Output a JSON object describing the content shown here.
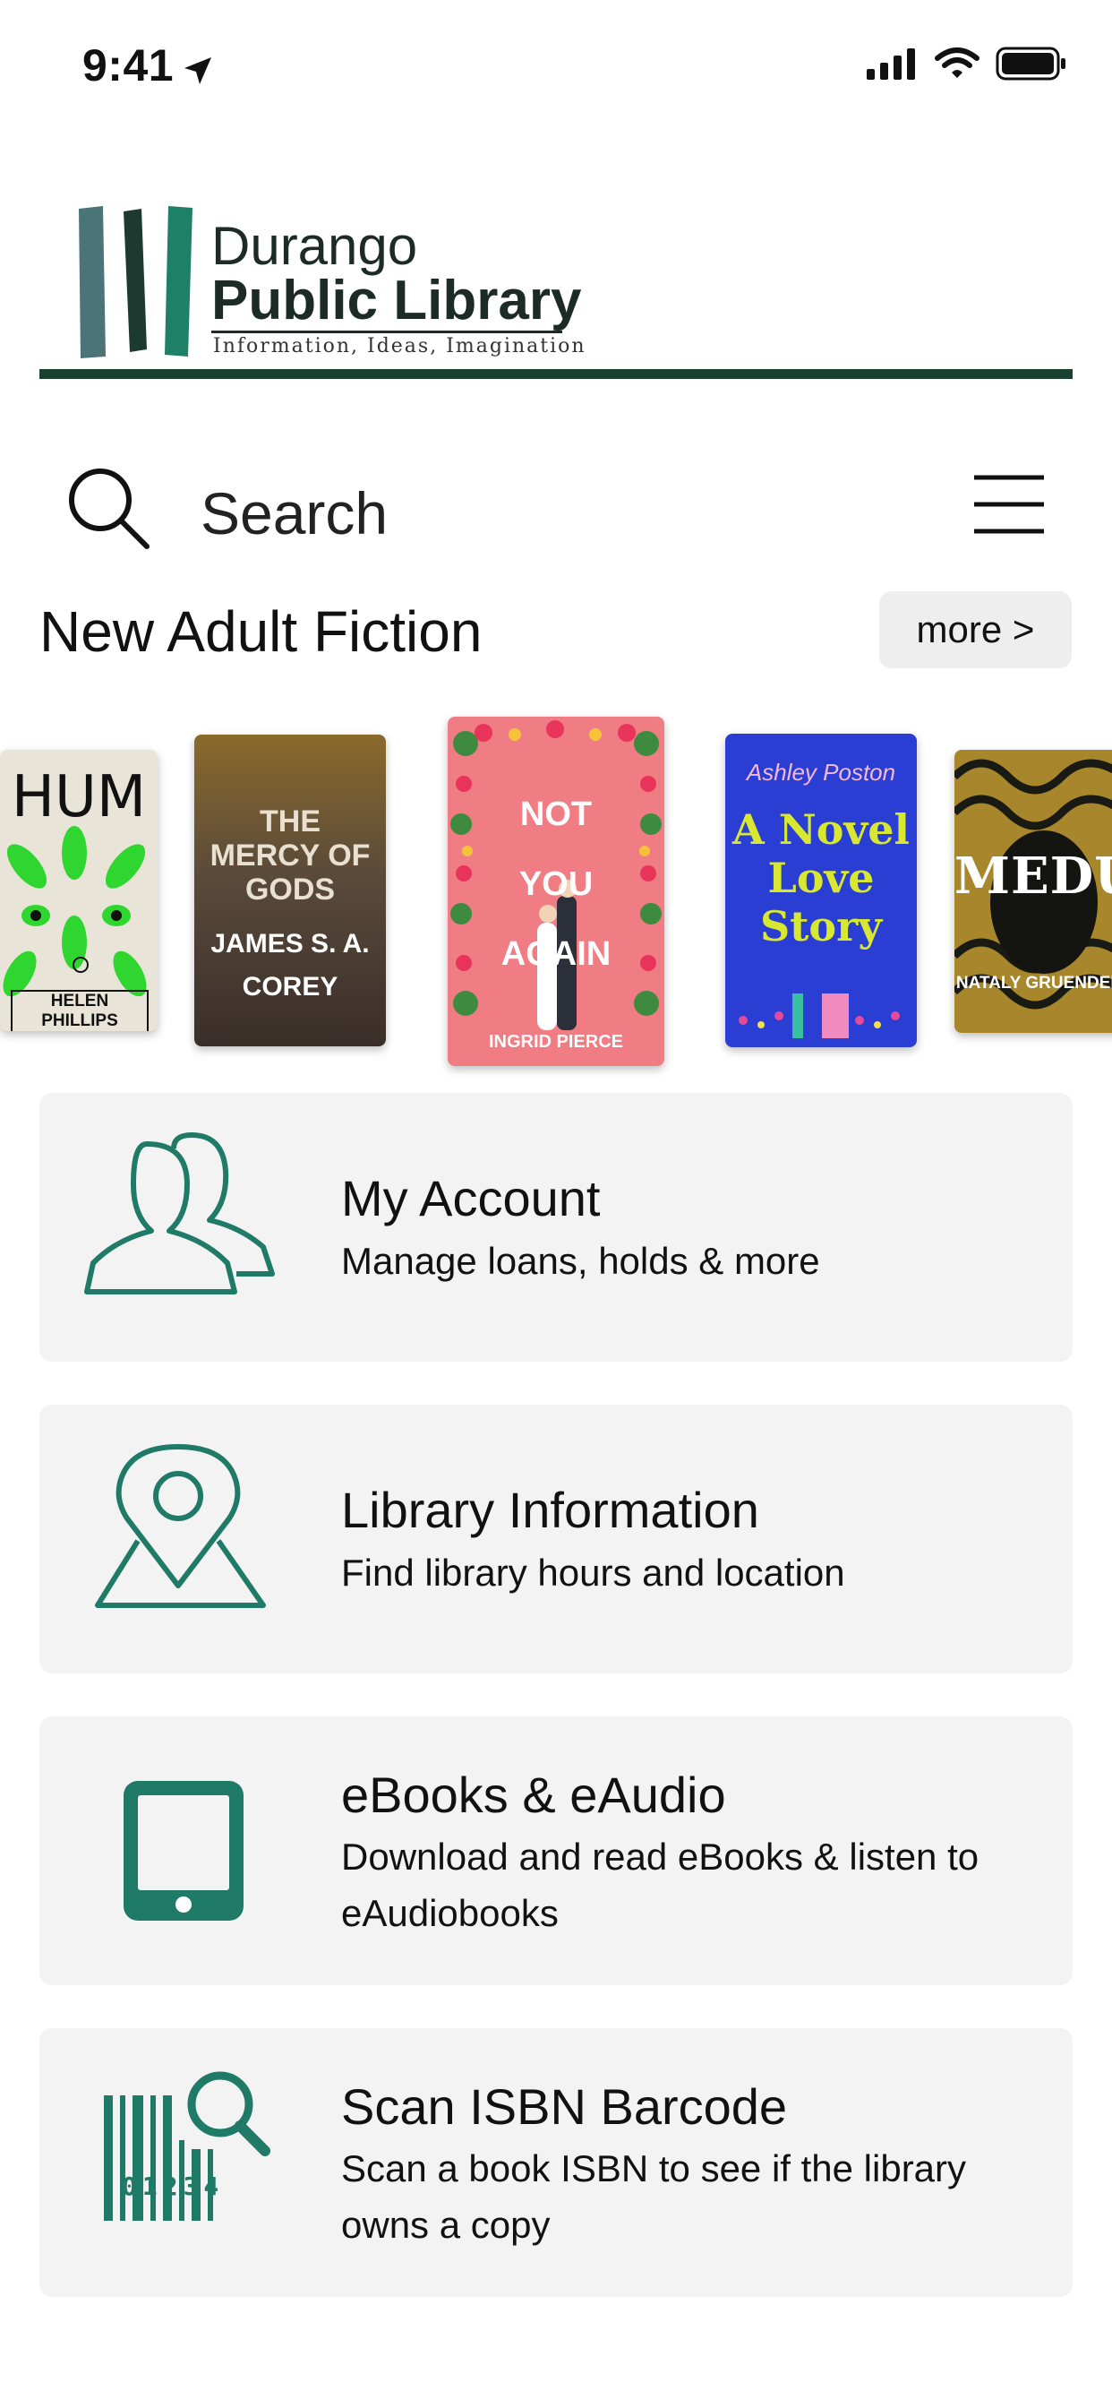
{
  "status": {
    "time": "9:41"
  },
  "logo": {
    "line1": "Durango",
    "line2": "Public Library",
    "tagline": "Information, Ideas, Imagination"
  },
  "search": {
    "label": "Search"
  },
  "section": {
    "title": "New Adult Fiction",
    "more_label": "more >"
  },
  "books": [
    {
      "title": "HUM",
      "author": "HELEN PHILLIPS"
    },
    {
      "title": "THE MERCY OF GODS",
      "author": "JAMES S. A. COREY"
    },
    {
      "title": "NOT YOU AGAIN",
      "author": "INGRID PIERCE"
    },
    {
      "title": "A Novel Love Story",
      "author": "Ashley Poston"
    },
    {
      "title": "MEDUSA",
      "author": "NATALY GRUENDER"
    }
  ],
  "cards": [
    {
      "title": "My Account",
      "subtitle": "Manage loans, holds & more",
      "icon": "account-icon"
    },
    {
      "title": "Library Information",
      "subtitle": "Find library hours and location",
      "icon": "map-pin-icon"
    },
    {
      "title": "eBooks & eAudio",
      "subtitle": "Download and read eBooks & listen to eAudiobooks",
      "icon": "tablet-icon"
    },
    {
      "title": "Scan ISBN Barcode",
      "subtitle": "Scan a book ISBN to see if the library owns a copy",
      "icon": "barcode-scan-icon",
      "barcode_digits": "01234"
    }
  ],
  "colors": {
    "brand_teal": "#1f7a68",
    "rule": "#1a4030",
    "card_bg": "#f3f3f3"
  }
}
